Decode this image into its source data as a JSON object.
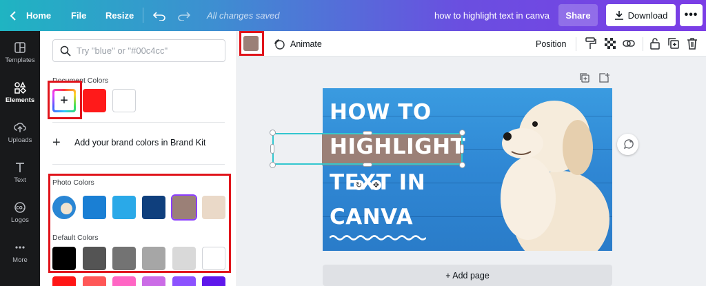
{
  "topbar": {
    "home_label": "Home",
    "file_label": "File",
    "resize_label": "Resize",
    "saved_status": "All changes saved",
    "doc_title": "how to highlight text in canva",
    "share_label": "Share",
    "download_label": "Download",
    "more_label": "•••"
  },
  "sidebar": {
    "items": [
      {
        "label": "Templates",
        "icon": "templates-icon"
      },
      {
        "label": "Elements",
        "icon": "elements-icon",
        "active": true
      },
      {
        "label": "Uploads",
        "icon": "uploads-icon"
      },
      {
        "label": "Text",
        "icon": "text-icon"
      },
      {
        "label": "Logos",
        "icon": "logos-icon"
      },
      {
        "label": "More",
        "icon": "more-dots-icon"
      }
    ]
  },
  "color_panel": {
    "search_placeholder": "Try \"blue\" or \"#00c4cc\"",
    "document_colors_label": "Document Colors",
    "document_colors": [
      "#ff1a1a",
      "#ffffff"
    ],
    "brand_kit_label": "Add your brand colors in Brand Kit",
    "photo_colors_label": "Photo Colors",
    "photo_colors": [
      "#1a7fd4",
      "#2aa9e8",
      "#0f3f7d",
      "#9b8077",
      "#ead9c8"
    ],
    "default_colors_label": "Default Colors",
    "default_colors_row1": [
      "#000000",
      "#545454",
      "#737373",
      "#a6a6a6",
      "#d9d9d9",
      "#ffffff"
    ],
    "default_colors_row2": [
      "#ff1616",
      "#ff5757",
      "#ff66c4",
      "#cb6ce6",
      "#8c52ff",
      "#5e17eb"
    ]
  },
  "context_toolbar": {
    "selected_color": "#9b8077",
    "animate_label": "Animate",
    "position_label": "Position"
  },
  "canvas": {
    "headline_lines": [
      "HOW TO",
      "HIGHLIGHT",
      "TEXT IN",
      "CANVA"
    ],
    "highlight_color": "#9b8077",
    "add_page_label": "+ Add page"
  },
  "annotation_color": "#e0141b"
}
